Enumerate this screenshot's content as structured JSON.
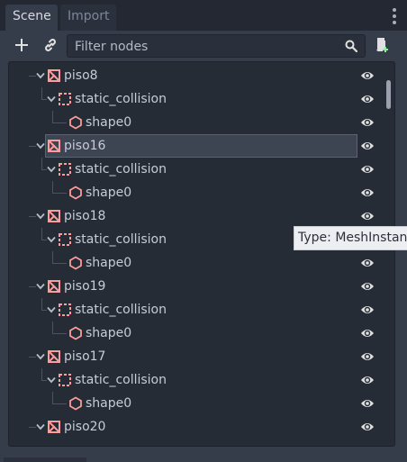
{
  "tabs": [
    {
      "label": "Scene",
      "active": true
    },
    {
      "label": "Import",
      "active": false
    }
  ],
  "toolbar": {
    "add_icon": "plus-icon",
    "link_icon": "link-icon",
    "filter_placeholder": "Filter nodes",
    "search_icon": "search-icon",
    "script_icon": "attach-script-icon"
  },
  "tree": {
    "rows": [
      {
        "label": "piso8",
        "type": "mesh"
      },
      {
        "label": "static_collision",
        "type": "static"
      },
      {
        "label": "shape0",
        "type": "shape"
      },
      {
        "label": "piso16",
        "type": "mesh",
        "selected": true
      },
      {
        "label": "static_collision",
        "type": "static"
      },
      {
        "label": "shape0",
        "type": "shape"
      },
      {
        "label": "piso18",
        "type": "mesh"
      },
      {
        "label": "static_collision",
        "type": "static"
      },
      {
        "label": "shape0",
        "type": "shape"
      },
      {
        "label": "piso19",
        "type": "mesh"
      },
      {
        "label": "static_collision",
        "type": "static"
      },
      {
        "label": "shape0",
        "type": "shape"
      },
      {
        "label": "piso17",
        "type": "mesh"
      },
      {
        "label": "static_collision",
        "type": "static"
      },
      {
        "label": "shape0",
        "type": "shape"
      },
      {
        "label": "piso20",
        "type": "mesh"
      }
    ]
  },
  "tooltip": {
    "text": "Type: MeshInstance"
  },
  "colors": {
    "accent": "#fc9c9c",
    "icon": "#e0e0e0"
  }
}
